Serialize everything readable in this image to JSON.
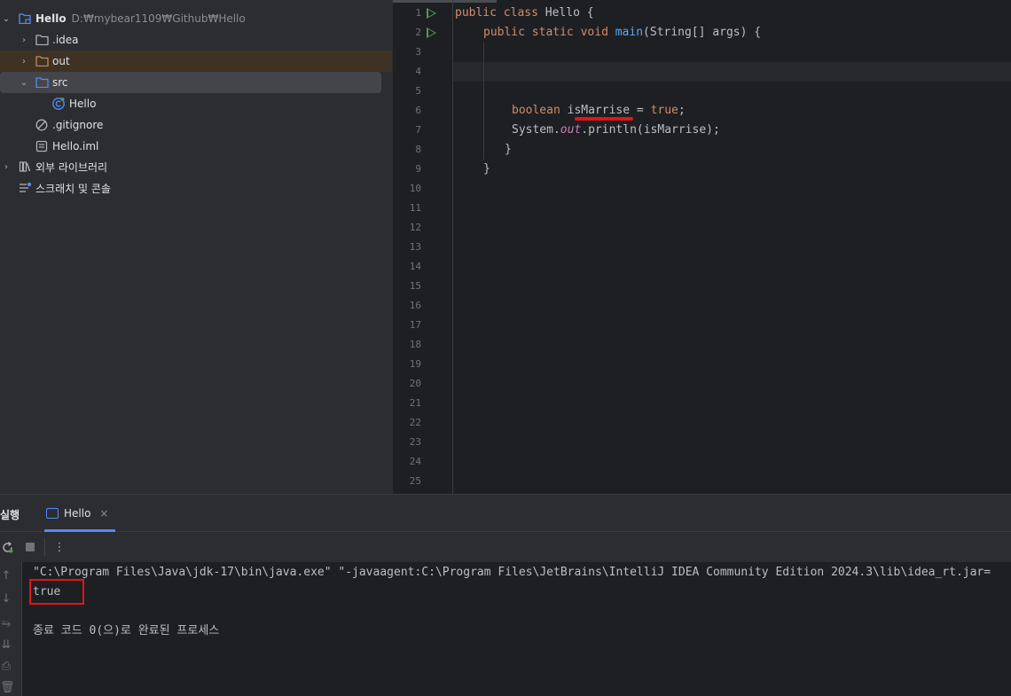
{
  "project": {
    "root": {
      "name": "Hello",
      "path": "D:₩mybear1109₩Github₩Hello"
    },
    "items": [
      {
        "label": ".idea",
        "type": "folder"
      },
      {
        "label": "out",
        "type": "folder"
      },
      {
        "label": "src",
        "type": "folder"
      },
      {
        "label": "Hello",
        "type": "class"
      },
      {
        "label": ".gitignore",
        "type": "file"
      },
      {
        "label": "Hello.iml",
        "type": "file"
      },
      {
        "label": "외부 라이브러리",
        "type": "library"
      },
      {
        "label": "스크래치 및 콘솔",
        "type": "scratch"
      }
    ]
  },
  "editor": {
    "line_numbers": [
      "1",
      "2",
      "3",
      "4",
      "5",
      "6",
      "7",
      "8",
      "9",
      "10",
      "11",
      "12",
      "13",
      "14",
      "15",
      "16",
      "17",
      "18",
      "19",
      "20",
      "21",
      "22",
      "23",
      "24",
      "25"
    ],
    "code": {
      "l1": {
        "kw1": "public",
        "kw2": "class",
        "rest": " Hello {"
      },
      "l2": {
        "kw1": "public",
        "kw2": "static",
        "kw3": "void",
        "fn": "main",
        "rest": "(String[] args) {"
      },
      "l6": {
        "kw1": "boolean",
        "var": "isMarrise",
        "eq": " = ",
        "val": "true",
        "end": ";"
      },
      "l7": {
        "pre": "System.",
        "out": "out",
        "rest": ".println(isMarrise);"
      },
      "l8": "}",
      "l9": "}"
    }
  },
  "run": {
    "title": "실행",
    "tab_label": "Hello",
    "tab_close": "×",
    "console": {
      "command": "\"C:\\Program Files\\Java\\jdk-17\\bin\\java.exe\" \"-javaagent:C:\\Program Files\\JetBrains\\IntelliJ IDEA Community Edition 2024.3\\lib\\idea_rt.jar=",
      "output": "true",
      "exit": "종료 코드 0(으)로 완료된 프로세스"
    }
  },
  "colors": {
    "keyword": "#cf8e6d",
    "function": "#56a8f5",
    "static_field": "#c77dbb",
    "highlight_box": "#e3141a",
    "accent": "#548af7"
  }
}
